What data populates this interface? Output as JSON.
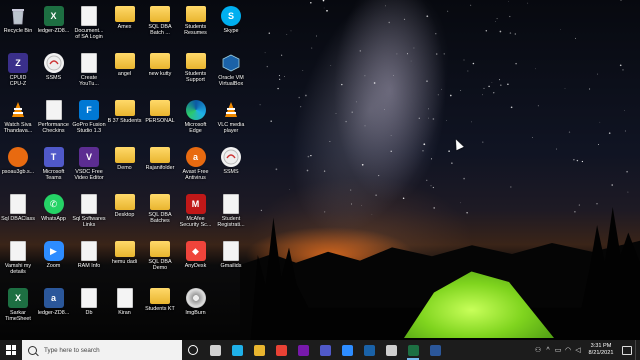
{
  "desktop": {
    "icons": [
      {
        "id": "recycle-bin",
        "label": "Recycle Bin",
        "glyph": "recycle-icon",
        "col": 0,
        "row": 0
      },
      {
        "id": "cpuid",
        "label": "CPUID\nCPU-Z",
        "glyph": "cpu-icon",
        "col": 0,
        "row": 1
      },
      {
        "id": "watch-siva",
        "label": "Watch Siva\nThandava...",
        "glyph": "vlc-icon",
        "col": 0,
        "row": 2
      },
      {
        "id": "psoau3gb",
        "label": "psoau3gb.s...",
        "glyph": "orange-icon",
        "col": 0,
        "row": 3
      },
      {
        "id": "sql-dbaclass",
        "label": "Sql DBAClass",
        "glyph": "doc-icon",
        "col": 0,
        "row": 4
      },
      {
        "id": "vamshi",
        "label": "Vamshi my\ndetails",
        "glyph": "doc-icon",
        "col": 0,
        "row": 5
      },
      {
        "id": "sarkar",
        "label": "Sarkar\nTimeSheet",
        "glyph": "excel-icon",
        "col": 0,
        "row": 6
      },
      {
        "id": "ledger1",
        "label": "ledger-ZD8...",
        "glyph": "excel-icon",
        "col": 1,
        "row": 0
      },
      {
        "id": "ssms1",
        "label": "SSMS",
        "glyph": "ssms-icon",
        "col": 1,
        "row": 1
      },
      {
        "id": "perf",
        "label": "Performance\nCheckins",
        "glyph": "doc-icon",
        "col": 1,
        "row": 2
      },
      {
        "id": "teams",
        "label": "Microsoft\nTeams",
        "glyph": "teams-icon",
        "col": 1,
        "row": 3
      },
      {
        "id": "whatsapp",
        "label": "WhatsApp",
        "glyph": "whatsapp-icon",
        "col": 1,
        "row": 4
      },
      {
        "id": "zoom",
        "label": "Zoom",
        "glyph": "zoom-icon",
        "col": 1,
        "row": 5
      },
      {
        "id": "ledger2",
        "label": "ledger-ZD8...",
        "glyph": "word-icon",
        "col": 1,
        "row": 6
      },
      {
        "id": "documentation",
        "label": "Document...\nof SA Login",
        "glyph": "doc-icon",
        "col": 2,
        "row": 0
      },
      {
        "id": "create-youtube",
        "label": "Create\nYouTu...",
        "glyph": "doc-icon",
        "col": 2,
        "row": 1
      },
      {
        "id": "gopro",
        "label": "GoPro Fusion\nStudio 1.3",
        "glyph": "gopro-icon",
        "col": 2,
        "row": 2
      },
      {
        "id": "vsdc",
        "label": "VSDC Free\nVideo Editor",
        "glyph": "vsdc-icon",
        "col": 2,
        "row": 3
      },
      {
        "id": "sql-softwares",
        "label": "Sql Softwares\nLinks",
        "glyph": "doc-icon",
        "col": 2,
        "row": 4
      },
      {
        "id": "ram-info",
        "label": "RAM Info",
        "glyph": "doc-icon",
        "col": 2,
        "row": 5
      },
      {
        "id": "db",
        "label": "Db",
        "glyph": "doc-icon",
        "col": 2,
        "row": 6
      },
      {
        "id": "amex",
        "label": "Amex",
        "glyph": "folderdoc-icon",
        "col": 3,
        "row": 0
      },
      {
        "id": "angel",
        "label": "angel",
        "glyph": "folderdoc-icon",
        "col": 3,
        "row": 1
      },
      {
        "id": "b37",
        "label": "B 37 Students",
        "glyph": "folder-icon",
        "col": 3,
        "row": 2
      },
      {
        "id": "demo1",
        "label": "Demo",
        "glyph": "folderdoc-icon",
        "col": 3,
        "row": 3
      },
      {
        "id": "desktop",
        "label": "Desktop",
        "glyph": "folder-icon",
        "col": 3,
        "row": 4
      },
      {
        "id": "hemu",
        "label": "hemu dadi",
        "glyph": "folder-icon",
        "col": 3,
        "row": 5
      },
      {
        "id": "kiran",
        "label": "Kiran",
        "glyph": "doc-icon",
        "col": 3,
        "row": 6
      },
      {
        "id": "sqldba-batch",
        "label": "SQL DBA\nBatch ...",
        "glyph": "folder-icon",
        "col": 4,
        "row": 0
      },
      {
        "id": "new-kutty",
        "label": "new kutty",
        "glyph": "folder-icon",
        "col": 4,
        "row": 1
      },
      {
        "id": "personal",
        "label": "PERSONAL",
        "glyph": "folder-icon",
        "col": 4,
        "row": 2
      },
      {
        "id": "rajanifolder",
        "label": "Rajanifolder",
        "glyph": "folder-icon",
        "col": 4,
        "row": 3
      },
      {
        "id": "sqldba-batches",
        "label": "SQL DBA\nBatches",
        "glyph": "folder-icon",
        "col": 4,
        "row": 4
      },
      {
        "id": "sqldba-demo",
        "label": "SQL DBA\nDemo",
        "glyph": "folder-icon",
        "col": 4,
        "row": 5
      },
      {
        "id": "students-kt",
        "label": "Students KT",
        "glyph": "folder-icon",
        "col": 4,
        "row": 6
      },
      {
        "id": "students-resumes",
        "label": "Students\nResumes",
        "glyph": "folder-icon",
        "col": 5,
        "row": 0
      },
      {
        "id": "students-support",
        "label": "Students\nSupport",
        "glyph": "folder-icon",
        "col": 5,
        "row": 1
      },
      {
        "id": "edge",
        "label": "Microsoft\nEdge",
        "glyph": "edge-icon",
        "col": 5,
        "row": 2
      },
      {
        "id": "avast",
        "label": "Avast Free\nAntivirus",
        "glyph": "avast-icon",
        "col": 5,
        "row": 3
      },
      {
        "id": "mcafee",
        "label": "McAfee\nSecurity Sc...",
        "glyph": "mcafee-icon",
        "col": 5,
        "row": 4
      },
      {
        "id": "anydesk",
        "label": "AnyDesk",
        "glyph": "anydesk-icon",
        "col": 5,
        "row": 5
      },
      {
        "id": "imgburn",
        "label": "ImgBurn",
        "glyph": "imgburn-icon",
        "col": 5,
        "row": 6
      },
      {
        "id": "skype",
        "label": "Skype",
        "glyph": "skype-icon",
        "col": 6,
        "row": 0
      },
      {
        "id": "oracle-vbox",
        "label": "Oracle VM\nVirtualBox",
        "glyph": "virtualbox-icon",
        "col": 6,
        "row": 1
      },
      {
        "id": "vlc",
        "label": "VLC media\nplayer",
        "glyph": "vlc-icon",
        "col": 6,
        "row": 2
      },
      {
        "id": "ssms2",
        "label": "SSMS",
        "glyph": "ssms-icon",
        "col": 6,
        "row": 3
      },
      {
        "id": "student-reg",
        "label": "Student\nRegistrati...",
        "glyph": "doc-icon",
        "col": 6,
        "row": 4
      },
      {
        "id": "gmailids",
        "label": "Gmailids",
        "glyph": "doc-icon",
        "col": 6,
        "row": 5
      }
    ]
  },
  "taskbar": {
    "search_placeholder": "Type here to search",
    "pinned": [
      {
        "name": "cortana-icon",
        "color": "#1c1c1c",
        "ring": true
      },
      {
        "name": "task-view-icon",
        "color": "#d0d0d0"
      },
      {
        "name": "edge-icon",
        "color": "#1fb0e8"
      },
      {
        "name": "file-explorer-icon",
        "color": "#e9b52f"
      },
      {
        "name": "chrome-icon",
        "color": "#e94235"
      },
      {
        "name": "onenote-icon",
        "color": "#7719aa"
      },
      {
        "name": "teams-icon",
        "color": "#5059c9"
      },
      {
        "name": "zoom-icon",
        "color": "#2d8cff"
      },
      {
        "name": "virtualbox-icon",
        "color": "#1a62a8"
      },
      {
        "name": "ssms-icon",
        "color": "#cfcfcf"
      },
      {
        "name": "excel-icon",
        "color": "#1d6f42",
        "active": true
      },
      {
        "name": "word-icon",
        "color": "#2b579a"
      }
    ],
    "clock": {
      "time": "3:31 PM",
      "date": "8/21/2021"
    }
  }
}
